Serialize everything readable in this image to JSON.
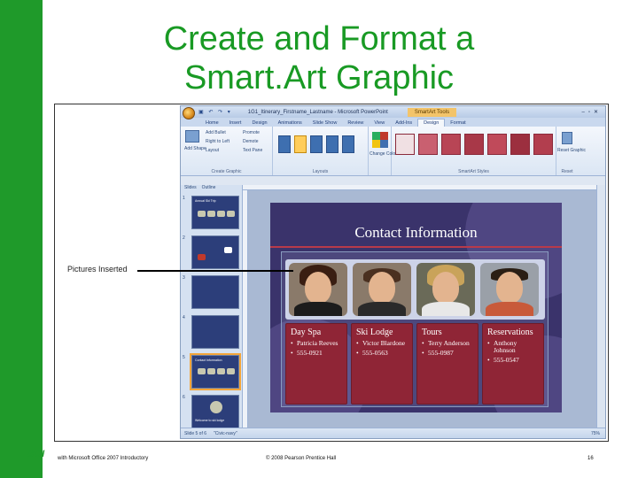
{
  "title": {
    "line1": "Create and Format a",
    "line2": "Smart.Art Graphic"
  },
  "callout": {
    "label": "Pictures Inserted"
  },
  "footer": {
    "logo": "GOI",
    "left": "with Microsoft Office 2007 Introductory",
    "middle": "© 2008 Pearson Prentice Hall",
    "page_number": "16"
  },
  "app": {
    "window_title": "1G1_Itinerary_Firstname_Lastname - Microsoft PowerPoint",
    "contextual_tab": "SmartArt Tools",
    "tabs": [
      "Home",
      "Insert",
      "Design",
      "Animations",
      "Slide Show",
      "Review",
      "View",
      "Add-Ins",
      "Design",
      "Format"
    ],
    "active_tab_index": 8,
    "ribbon": {
      "create_graphic": {
        "label": "Create Graphic",
        "add_shape": "Add Shape",
        "add_bullet": "Add Bullet",
        "right_to_left": "Right to Left",
        "layout": "Layout",
        "promote": "Promote",
        "demote": "Demote",
        "text_pane": "Text Pane"
      },
      "layouts": {
        "label": "Layouts"
      },
      "change_colors": "Change Colors",
      "smartart_styles": {
        "label": "SmartArt Styles"
      },
      "reset": {
        "label": "Reset",
        "reset_graphic": "Reset Graphic"
      }
    },
    "pane_tabs": [
      "Slides",
      "Outline"
    ],
    "status": {
      "slide_info": "Slide 5 of 6",
      "theme": "\"Civic-navy\"",
      "zoom": "75%"
    }
  },
  "slide": {
    "title": "Contact Information",
    "accent_color": "#8f2536",
    "background_color": "#3a336b",
    "contacts": [
      {
        "place": "Day Spa",
        "name": "Patricia Reeves",
        "phone": "555-0921"
      },
      {
        "place": "Ski Lodge",
        "name": "Victor Blardone",
        "phone": "555-0563"
      },
      {
        "place": "Tours",
        "name": "Terry Anderson",
        "phone": "555-0987"
      },
      {
        "place": "Reservations",
        "name": "Anthony Johnson",
        "phone": "555-0547"
      }
    ]
  },
  "thumbnails": [
    {
      "num": "1",
      "text": "Annual Ski Trip"
    },
    {
      "num": "2",
      "text": ""
    },
    {
      "num": "3",
      "text": ""
    },
    {
      "num": "4",
      "text": ""
    },
    {
      "num": "5",
      "text": "Contact Information"
    },
    {
      "num": "6",
      "text": "Welcome to ski lodge"
    }
  ]
}
